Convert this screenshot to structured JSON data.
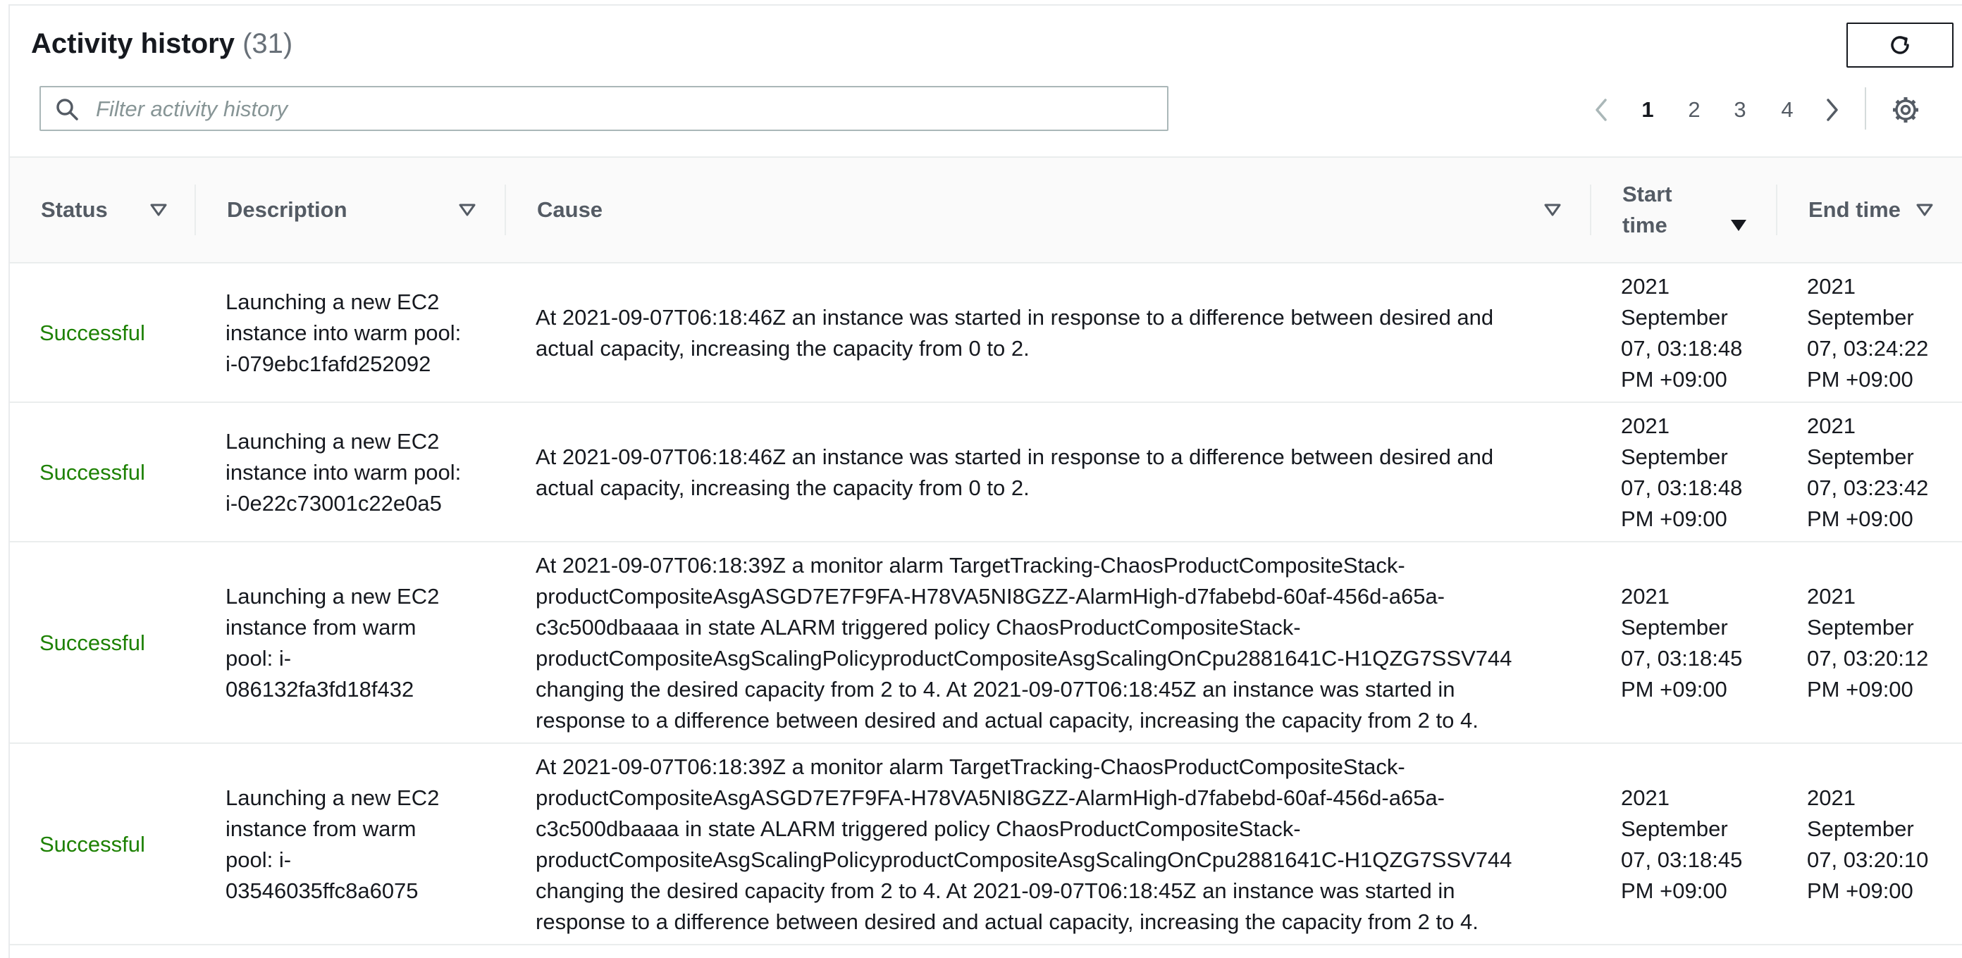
{
  "header": {
    "title": "Activity history",
    "count": "(31)",
    "refresh_icon": "refresh-icon"
  },
  "search": {
    "placeholder": "Filter activity history",
    "value": "",
    "icon": "search-icon"
  },
  "pagination": {
    "pages": [
      "1",
      "2",
      "3",
      "4"
    ],
    "current_page": "1",
    "prev_icon": "chevron-left-icon",
    "next_icon": "chevron-right-icon",
    "settings_icon": "gear-icon"
  },
  "table": {
    "columns": {
      "status": "Status",
      "description": "Description",
      "cause": "Cause",
      "start_time_1": "Start",
      "start_time_2": "time",
      "end_time": "End time"
    },
    "sorted_column": "Start time",
    "rows": [
      {
        "status": "Successful",
        "description": [
          "Launching a new EC2",
          "instance into warm pool:",
          "i-079ebc1fafd252092"
        ],
        "cause": [
          "At 2021-09-07T06:18:46Z an instance was started in response to a difference between desired and",
          "actual capacity, increasing the capacity from 0 to 2."
        ],
        "start_time": [
          "2021",
          "September",
          "07, 03:18:48",
          "PM +09:00"
        ],
        "end_time": [
          "2021",
          "September",
          "07, 03:24:22",
          "PM +09:00"
        ]
      },
      {
        "status": "Successful",
        "description": [
          "Launching a new EC2",
          "instance into warm pool:",
          "i-0e22c73001c22e0a5"
        ],
        "cause": [
          "At 2021-09-07T06:18:46Z an instance was started in response to a difference between desired and",
          "actual capacity, increasing the capacity from 0 to 2."
        ],
        "start_time": [
          "2021",
          "September",
          "07, 03:18:48",
          "PM +09:00"
        ],
        "end_time": [
          "2021",
          "September",
          "07, 03:23:42",
          "PM +09:00"
        ]
      },
      {
        "status": "Successful",
        "description": [
          "Launching a new EC2",
          "instance from warm",
          "pool: i-",
          "086132fa3fd18f432"
        ],
        "cause": [
          "At 2021-09-07T06:18:39Z a monitor alarm TargetTracking-ChaosProductCompositeStack-",
          "productCompositeAsgASGD7E7F9FA-H78VA5NI8GZZ-AlarmHigh-d7fabebd-60af-456d-a65a-",
          "c3c500dbaaaa in state ALARM triggered policy ChaosProductCompositeStack-",
          "productCompositeAsgScalingPolicyproductCompositeAsgScalingOnCpu2881641C-H1QZG7SSV744",
          "changing the desired capacity from 2 to 4. At 2021-09-07T06:18:45Z an instance was started in",
          "response to a difference between desired and actual capacity, increasing the capacity from 2 to 4."
        ],
        "start_time": [
          "2021",
          "September",
          "07, 03:18:45",
          "PM +09:00"
        ],
        "end_time": [
          "2021",
          "September",
          "07, 03:20:12",
          "PM +09:00"
        ]
      },
      {
        "status": "Successful",
        "description": [
          "Launching a new EC2",
          "instance from warm",
          "pool: i-",
          "03546035ffc8a6075"
        ],
        "cause": [
          "At 2021-09-07T06:18:39Z a monitor alarm TargetTracking-ChaosProductCompositeStack-",
          "productCompositeAsgASGD7E7F9FA-H78VA5NI8GZZ-AlarmHigh-d7fabebd-60af-456d-a65a-",
          "c3c500dbaaaa in state ALARM triggered policy ChaosProductCompositeStack-",
          "productCompositeAsgScalingPolicyproductCompositeAsgScalingOnCpu2881641C-H1QZG7SSV744",
          "changing the desired capacity from 2 to 4. At 2021-09-07T06:18:45Z an instance was started in",
          "response to a difference between desired and actual capacity, increasing the capacity from 2 to 4."
        ],
        "start_time": [
          "2021",
          "September",
          "07, 03:18:45",
          "PM +09:00"
        ],
        "end_time": [
          "2021",
          "September",
          "07, 03:20:10",
          "PM +09:00"
        ]
      }
    ]
  },
  "colors": {
    "success": "#1d8102",
    "header_text": "#545b64",
    "muted": "#687078"
  }
}
